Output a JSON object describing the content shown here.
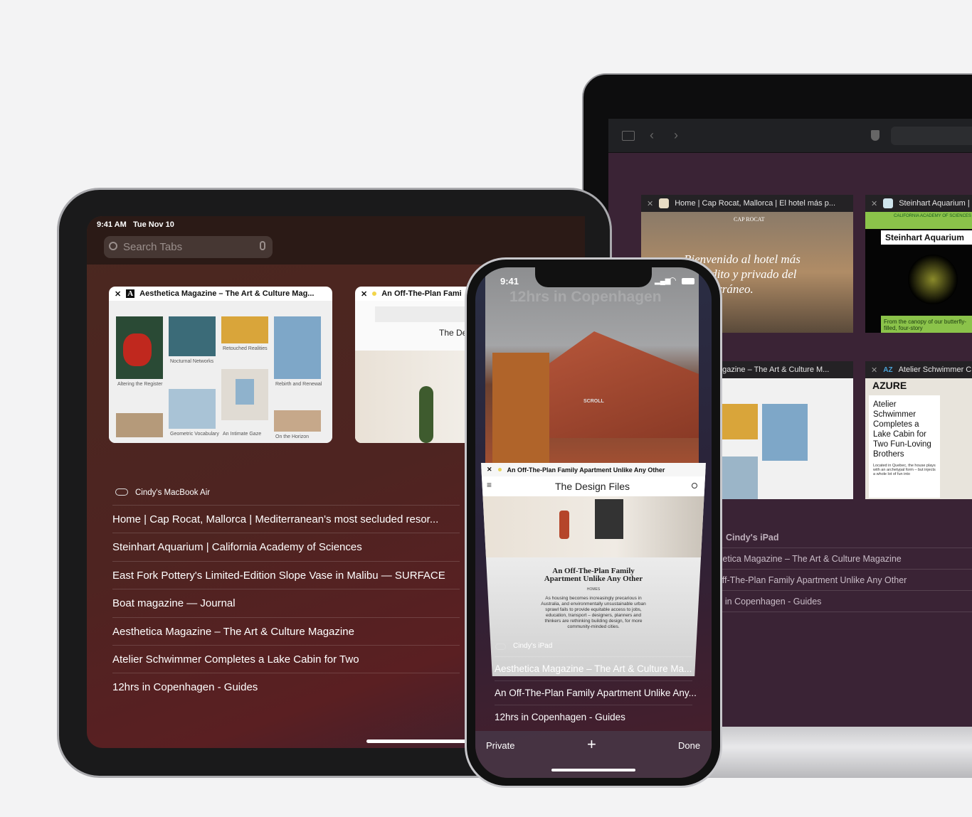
{
  "mac": {
    "toolbar_icons": [
      "sidebar-icon",
      "chevron-left-icon",
      "chevron-right-icon",
      "shield-icon"
    ],
    "tabs": [
      {
        "title": "Home | Cap Rocat, Mallorca | El hotel más p...",
        "hero": "Bienvenido al hotel más recóndito y privado del Mediterráneo.",
        "logo": "CAP ROCAT"
      },
      {
        "title": "Steinhart Aquarium |",
        "heading": "Steinhart Aquarium",
        "org": "CALIFORNIA ACADEMY OF SCIENCES",
        "caption": "From the canopy of our butterfly-filled, four-story"
      },
      {
        "title": "agazine – The Art & Culture M..."
      },
      {
        "title": "Atelier Schwimmer C",
        "favicon": "AZ",
        "brand": "AZURE",
        "headline": "Atelier Schwimmer Completes a Lake Cabin for Two Fun-Loving Brothers",
        "blurb": "Located in Quebec, the house plays with an archetypal form – but injects a whole lot of fun into"
      }
    ],
    "device_label": "Cindy's iPad",
    "list": [
      "thetica Magazine – The Art & Culture Magazine",
      "Off-The-Plan Family Apartment Unlike Any Other",
      "rs in Copenhagen - Guides"
    ]
  },
  "ipad": {
    "time": "9:41 AM",
    "date": "Tue Nov 10",
    "search_placeholder": "Search Tabs",
    "tabs": [
      {
        "title": "Aesthetica Magazine – The Art & Culture Mag...",
        "favicon": "A",
        "captions": [
          "Altering the Register",
          "Nocturnal Networks",
          "Retouched Realities",
          "Rebirth and Renewal",
          "Geometric Vocabulary",
          "An Intimate Gaze",
          "On the Horizon"
        ]
      },
      {
        "title": "An Off-The-Plan Fami",
        "site": "The Des"
      }
    ],
    "device_label": "Cindy's MacBook Air",
    "list": [
      "Home | Cap Rocat, Mallorca | Mediterranean's most secluded resor...",
      "Steinhart Aquarium | California Academy of Sciences",
      "East Fork Pottery's Limited-Edition Slope Vase in Malibu — SURFACE",
      "Boat magazine — Journal",
      "Aesthetica Magazine – The Art & Culture Magazine",
      "Atelier Schwimmer Completes a Lake Cabin for Two",
      "12hrs in Copenhagen - Guides"
    ]
  },
  "iphone": {
    "time": "9:41",
    "back_tab_title": "12hrs in Copenhagen",
    "scroll_label": "SCROLL",
    "front_tab": {
      "title": "An Off-The-Plan Family Apartment Unlike Any Other",
      "site": "The Design Files",
      "headline": "An Off-The-Plan Family Apartment Unlike Any Other",
      "category": "HOMES",
      "body": "As housing becomes increasingly precarious in Australia, and environmentally unsustainable urban sprawl fails to provide equitable access to jobs, education, transport – designers, planners and thinkers are rethinking building design, for more community-minded cities."
    },
    "device_label": "Cindy's iPad",
    "list": [
      "Aesthetica Magazine – The Art & Culture Ma...",
      "An Off-The-Plan Family Apartment Unlike Any...",
      "12hrs in Copenhagen - Guides"
    ],
    "private_label": "Private",
    "done_label": "Done"
  }
}
